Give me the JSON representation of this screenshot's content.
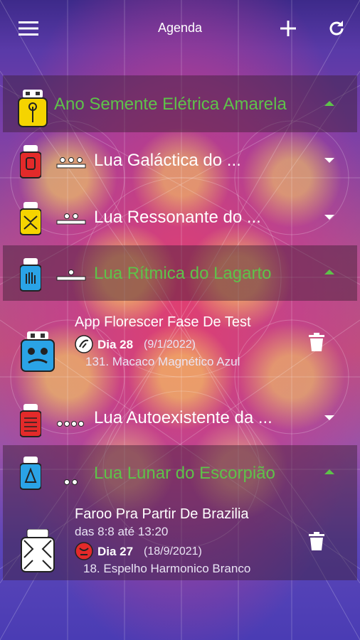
{
  "topbar": {
    "title": "Agenda",
    "menu_icon": "menu-icon",
    "add_icon": "plus-icon",
    "refresh_icon": "refresh-icon"
  },
  "colors": {
    "accent_green": "#5ec24a",
    "white": "#ffffff"
  },
  "year": {
    "label": "Ano Semente Elétrica Amarela",
    "expanded": true
  },
  "moons": [
    {
      "label": "Lua Galáctica do ...",
      "expanded": false
    },
    {
      "label": "Lua Ressonante do ...",
      "expanded": false
    },
    {
      "label": "Lua Rítmica do Lagarto",
      "expanded": true
    },
    {
      "label": "Lua Autoexistente da ...",
      "expanded": false
    },
    {
      "label": "Lua Lunar do Escorpião",
      "expanded": true
    }
  ],
  "events": [
    {
      "title": "App Florescer Fase De Test",
      "day": "Dia 28",
      "date": "(9/1/2022)",
      "kin": "131. Macaco Magnético Azul"
    },
    {
      "title": "Faroo Pra Partir De Brazilia",
      "time": "das 8:8 até 13:20",
      "day": "Dia 27",
      "date": "(18/9/2021)",
      "kin": "18. Espelho Harmonico Branco"
    }
  ]
}
